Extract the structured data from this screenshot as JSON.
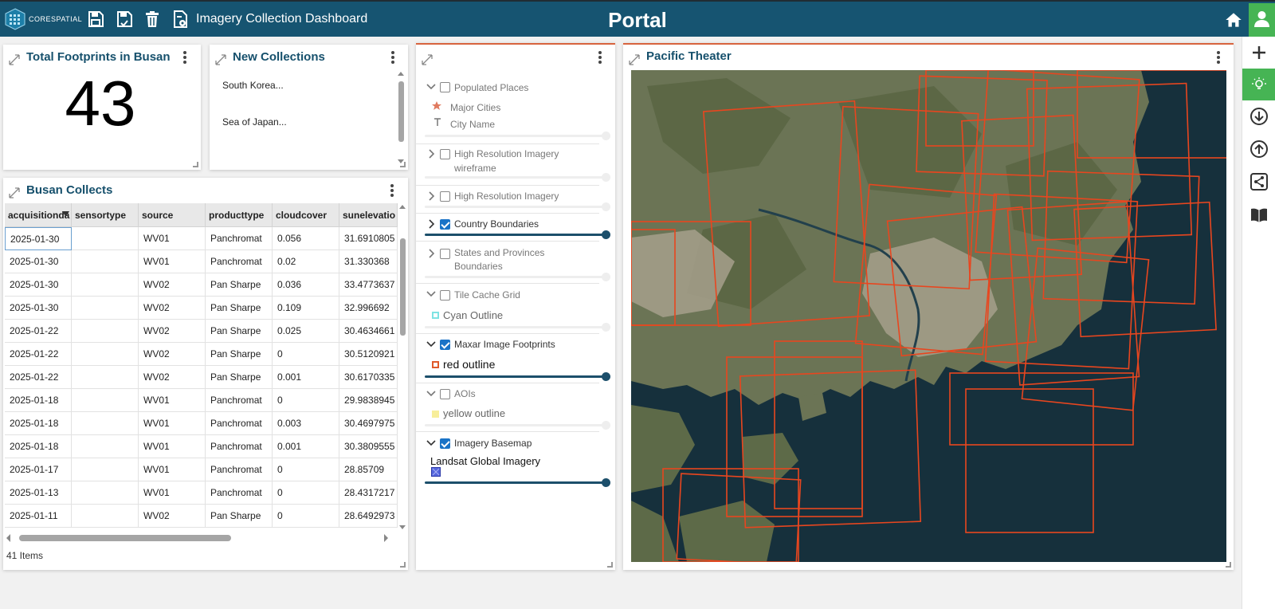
{
  "header": {
    "logo_text": "CORESPATIAL",
    "app_title": "Imagery Collection Dashboard",
    "portal_title": "Portal",
    "bg_color": "#165471",
    "toolbar_icons": [
      "save-icon",
      "save-as-icon",
      "trash-icon",
      "document-settings-icon"
    ]
  },
  "rail": {
    "buttons": [
      "plus-icon",
      "lightbulb-icon",
      "download-circle-icon",
      "upload-circle-icon",
      "share-icon",
      "book-icon"
    ],
    "active_color": "#46b454"
  },
  "footprints": {
    "title": "Total Footprints in Busan",
    "count": "43"
  },
  "new_collections": {
    "title": "New Collections",
    "items": [
      "South Korea...",
      "Sea of Japan..."
    ]
  },
  "collects": {
    "title": "Busan Collects",
    "columns": [
      "acquisitionda",
      "sensortype",
      "source",
      "producttype",
      "cloudcover",
      "sunelevatio"
    ],
    "rows": [
      [
        "2025-01-30",
        "",
        "WV01",
        "Panchromat",
        "0.056",
        "31.6910805"
      ],
      [
        "2025-01-30",
        "",
        "WV01",
        "Panchromat",
        "0.02",
        "31.330368"
      ],
      [
        "2025-01-30",
        "",
        "WV02",
        "Pan Sharpe",
        "0.036",
        "33.4773637"
      ],
      [
        "2025-01-30",
        "",
        "WV02",
        "Pan Sharpe",
        "0.109",
        "32.996692"
      ],
      [
        "2025-01-22",
        "",
        "WV02",
        "Pan Sharpe",
        "0.025",
        "30.4634661"
      ],
      [
        "2025-01-22",
        "",
        "WV02",
        "Pan Sharpe",
        "0",
        "30.5120921"
      ],
      [
        "2025-01-22",
        "",
        "WV02",
        "Pan Sharpe",
        "0.001",
        "30.6170335"
      ],
      [
        "2025-01-18",
        "",
        "WV01",
        "Panchromat",
        "0",
        "29.9838945"
      ],
      [
        "2025-01-18",
        "",
        "WV01",
        "Panchromat",
        "0.003",
        "30.4697975"
      ],
      [
        "2025-01-18",
        "",
        "WV01",
        "Panchromat",
        "0.001",
        "30.3809555"
      ],
      [
        "2025-01-17",
        "",
        "WV01",
        "Panchromat",
        "0",
        "28.85709"
      ],
      [
        "2025-01-13",
        "",
        "WV01",
        "Panchromat",
        "0",
        "28.4317217"
      ],
      [
        "2025-01-11",
        "",
        "WV02",
        "Pan Sharpe",
        "0",
        "28.6492973"
      ]
    ],
    "items_label": "41 Items"
  },
  "layers": {
    "groups": [
      {
        "name": "Populated Places",
        "checked": false,
        "expanded": true,
        "legend": [
          {
            "icon": "star-icon",
            "label": "Major Cities",
            "color": "#e07a5f"
          },
          {
            "icon": "text-icon",
            "label": "City Name",
            "color": "#777777"
          }
        ]
      },
      {
        "name": "High Resolution Imagery",
        "name2": "wireframe",
        "checked": false,
        "expanded": false
      },
      {
        "name": "High Resolution Imagery",
        "checked": false,
        "expanded": false
      },
      {
        "name": "Country Boundaries",
        "checked": true,
        "expanded": false
      },
      {
        "name": "States and Provinces",
        "name2": "Boundaries",
        "checked": false,
        "expanded": false
      },
      {
        "name": "Tile Cache Grid",
        "checked": false,
        "expanded": true,
        "legend": [
          {
            "label": "Cyan Outline",
            "color": "#7fe3e3"
          }
        ]
      },
      {
        "name": "Maxar Image Footprints",
        "checked": true,
        "expanded": true,
        "legend": [
          {
            "label": "red outline",
            "color": "#e05a2b"
          }
        ]
      },
      {
        "name": "AOIs",
        "checked": false,
        "expanded": true,
        "legend": [
          {
            "label": "yellow outline",
            "color": "#f2e07a"
          }
        ]
      },
      {
        "name": "Imagery Basemap",
        "checked": true,
        "expanded": true,
        "legend": [
          {
            "label": "Landsat Global Imagery",
            "color": "#3d4fc9"
          }
        ]
      }
    ]
  },
  "map": {
    "title": "Pacific Theater",
    "footprint_color": "#e8461f",
    "water_color": "#16303c",
    "land_color": "#6a7356"
  }
}
